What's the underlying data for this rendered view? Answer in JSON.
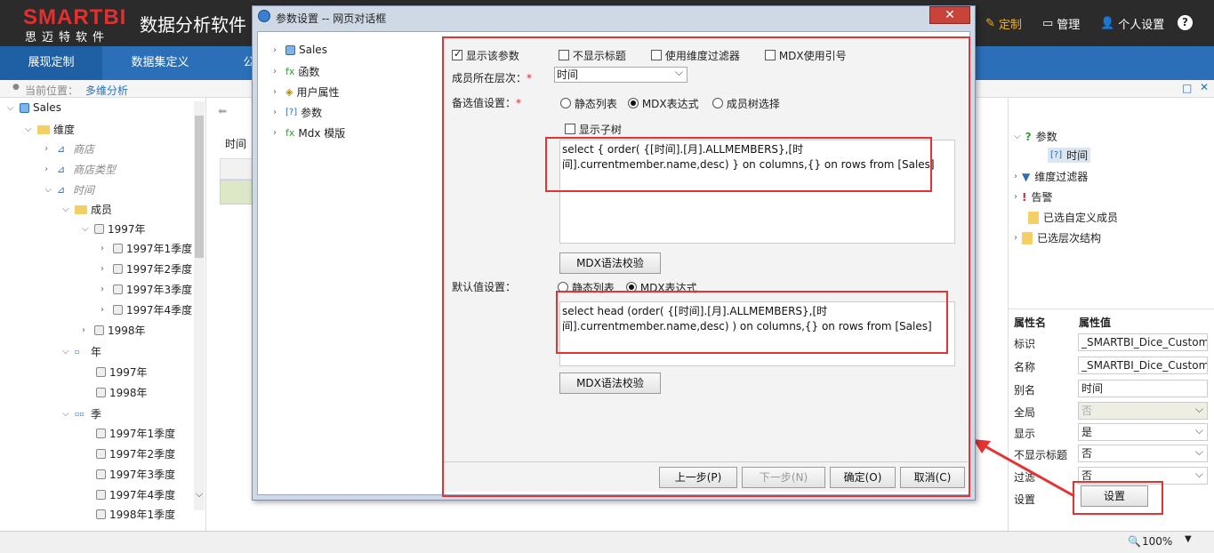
{
  "header": {
    "logo": "SMARTBI",
    "logo_sub": "思迈特软件",
    "app_title": "数据分析软件",
    "nav": [
      {
        "label": "定制",
        "icon": "pencil-icon"
      },
      {
        "label": "管理",
        "icon": "monitor-icon"
      },
      {
        "label": "个人设置",
        "icon": "user-icon"
      }
    ],
    "help_icon": "question-icon"
  },
  "main_nav": {
    "tabs": [
      "展现定制",
      "数据集定义",
      "公"
    ]
  },
  "breadcrumb": {
    "prefix": "当前位置：",
    "current": "多维分析"
  },
  "left_tree": {
    "root": "Sales",
    "dimension": "维度",
    "items": [
      "商店",
      "商店类型",
      "时间"
    ],
    "members_folder": "成员",
    "year_1997": "1997年",
    "quarters_1997": [
      "1997年1季度",
      "1997年2季度",
      "1997年3季度",
      "1997年4季度"
    ],
    "year_1998": "1998年",
    "level_year": "年",
    "level_year_items": [
      "1997年",
      "1998年"
    ],
    "level_quarter": "季",
    "level_quarter_items": [
      "1997年1季度",
      "1997年2季度",
      "1997年3季度",
      "1997年4季度",
      "1998年1季度"
    ]
  },
  "mid": {
    "label": "时间"
  },
  "right_panel": {
    "tree": {
      "params": "参数",
      "time": "时间",
      "dim_filter": "维度过滤器",
      "alert": "告警",
      "custom_members": "已选自定义成员",
      "hierarchy": "已选层次结构"
    },
    "prop_header": [
      "属性名",
      "属性值"
    ],
    "props": [
      {
        "name": "标识",
        "value": "_SMARTBI_Dice_Custom"
      },
      {
        "name": "名称",
        "value": "_SMARTBI_Dice_Custom"
      },
      {
        "name": "别名",
        "value": "时间"
      },
      {
        "name": "全局",
        "value": "否"
      },
      {
        "name": "显示",
        "value": "是"
      },
      {
        "name": "不显示标题",
        "value": "否"
      },
      {
        "name": "过滤",
        "value": "否"
      },
      {
        "name": "设置",
        "value": ""
      }
    ],
    "settings_button": "设置"
  },
  "status": {
    "zoom": "100%"
  },
  "dialog": {
    "title": "参数设置 -- 网页对话框",
    "close": "✕",
    "left_tree": [
      "Sales",
      "函数",
      "用户属性",
      "参数",
      "Mdx 模版"
    ],
    "checks": {
      "show_param": "显示该参数",
      "hide_title": "不显示标题",
      "use_dim_filter": "使用维度过滤器",
      "mdx_quote": "MDX使用引号"
    },
    "level_label": "成员所在层次：",
    "level_value": "时间",
    "candidate_label": "备选值设置：",
    "candidate_options": [
      "静态列表",
      "MDX表达式",
      "成员树选择"
    ],
    "show_subtree": "显示子树",
    "candidate_mdx_line1": "select { order( {[时间].[月].ALLMEMBERS},[时",
    "candidate_mdx_line2": "间].currentmember.name,desc) } on columns,{} on rows from [Sales]",
    "validate_btn": "MDX语法校验",
    "default_label": "默认值设置：",
    "default_options": [
      "静态列表",
      "MDX表达式"
    ],
    "default_mdx_line1": "select head (order( {[时间].[月].ALLMEMBERS},[时",
    "default_mdx_line2": "间].currentmember.name,desc) ) on columns,{} on rows from [Sales]",
    "buttons": {
      "prev": "上一步(P)",
      "next": "下一步(N)",
      "ok": "确定(O)",
      "cancel": "取消(C)"
    }
  },
  "colors": {
    "accent": "#2a6fb7",
    "highlight": "#e53333",
    "header_bg": "#2b2b2b"
  }
}
